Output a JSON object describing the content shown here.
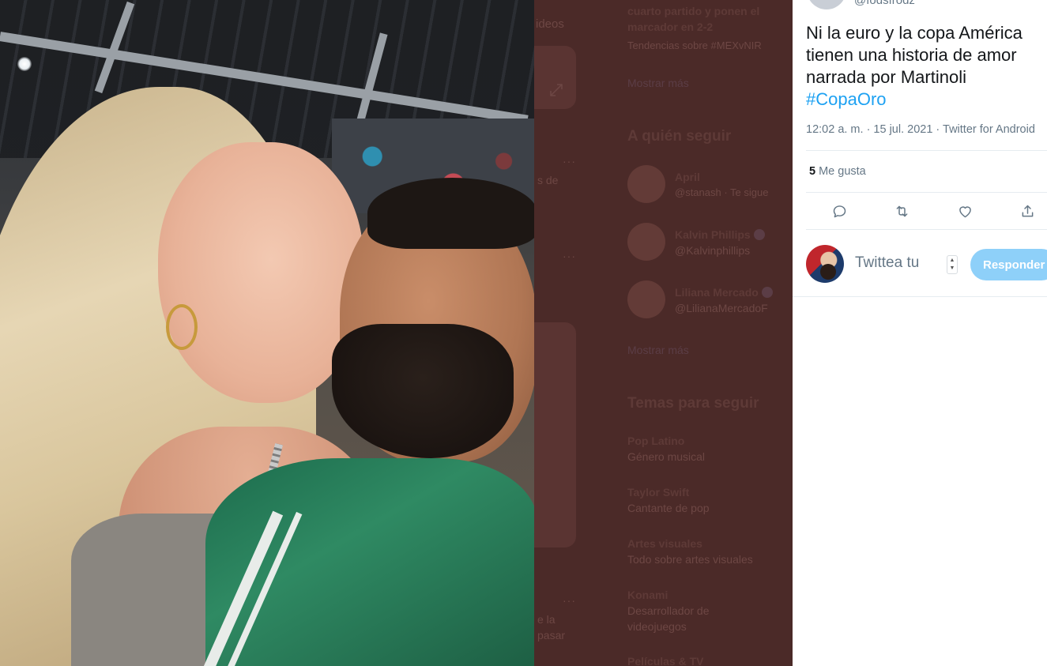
{
  "tweet": {
    "author_handle": "@fodsfrodz",
    "text": "Ni la euro y la copa América tienen una historia de amor narrada por Martinoli",
    "hashtag": "#CopaOro",
    "meta": "12:02 a. m. · 15 jul. 2021 · Twitter for Android",
    "likes_count": "5",
    "likes_label": "Me gusta",
    "reply_placeholder": "Twittea tu",
    "reply_button": "Responder"
  },
  "background": {
    "top_tab": "ideos",
    "trend_text_1": "cuarto partido y ponen el",
    "trend_text_2": "marcador en 2-2",
    "trend_source": "Tendencias sobre #MEXvNIR",
    "show_more_1": "Mostrar más",
    "who_to_follow": "A quién seguir",
    "follow": [
      {
        "name": "April",
        "handle": "@stanash · Te sigue"
      },
      {
        "name": "Kalvin Phillips",
        "handle": "@Kalvinphillips"
      },
      {
        "name": "Liliana Mercado",
        "handle": "@LilianaMercadoF"
      }
    ],
    "show_more_2": "Mostrar más",
    "topics_heading": "Temas para seguir",
    "topics": [
      {
        "name": "Pop Latino",
        "desc": "Género musical"
      },
      {
        "name": "Taylor Swift",
        "desc": "Cantante de pop"
      },
      {
        "name": "Artes visuales",
        "desc": "Todo sobre artes visuales"
      },
      {
        "name": "Konami",
        "desc": "Desarrollador de",
        "desc2": "videojuegos"
      },
      {
        "name": "Películas & TV",
        "desc": ""
      }
    ],
    "fragment_1": "s de",
    "fragment_2": "e la",
    "fragment_3": "pasar",
    "dots": "···"
  },
  "icons": [
    "reply-icon",
    "retweet-icon",
    "like-icon",
    "share-icon",
    "expand-icon"
  ],
  "colors": {
    "accent": "#1da1f2",
    "reply_button_disabled": "#8ed0f9",
    "overlay": "#4b2a28",
    "secondary_text": "#657786",
    "primary_text": "#14171a"
  }
}
